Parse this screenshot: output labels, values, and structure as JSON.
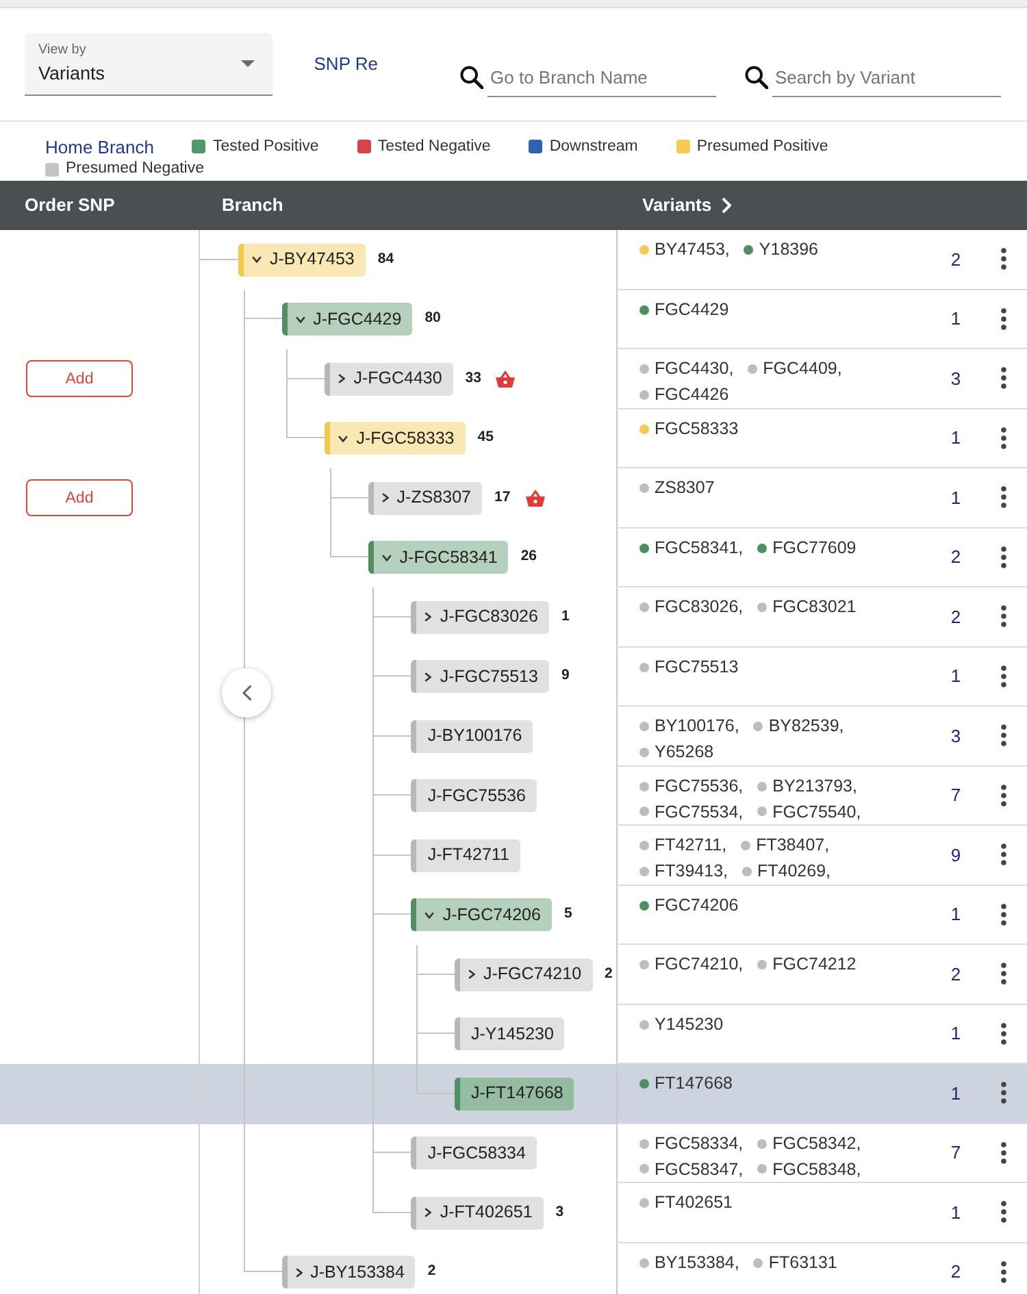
{
  "toolbar": {
    "view_by": {
      "label": "View by",
      "value": "Variants"
    },
    "tab": "SNP Re",
    "branch_search": {
      "placeholder": "Go to Branch Name"
    },
    "variant_search": {
      "placeholder": "Search by Variant"
    }
  },
  "legend": {
    "home_branch": "Home Branch",
    "items": [
      {
        "label": "Tested Positive",
        "color": "#4e9a66"
      },
      {
        "label": "Tested Negative",
        "color": "#d64545"
      },
      {
        "label": "Downstream",
        "color": "#2f63ad"
      },
      {
        "label": "Presumed Positive",
        "color": "#f6c94f"
      },
      {
        "label": "Presumed Negative",
        "color": "#c4c4c4"
      }
    ]
  },
  "table": {
    "columns": [
      {
        "label": "Order SNP",
        "kind": "plain"
      },
      {
        "label": "Branch",
        "kind": "plain"
      },
      {
        "label": "Variants",
        "kind": "expandable"
      }
    ],
    "tree": [
      {
        "name": "J-BY47453",
        "color": "#f2c94c",
        "kind": "parent",
        "expanded": true,
        "count": "84",
        "basket": false,
        "selected": false,
        "variants": [
          {
            "name": "BY47453,",
            "color": "#f6c94f"
          },
          {
            "name": "Y18396",
            "color": "#4e8f60"
          }
        ],
        "variant_count": "2",
        "children": [
          {
            "name": "J-FGC4429",
            "color": "#4f8f60",
            "kind": "parent",
            "expanded": true,
            "count": "80",
            "basket": false,
            "selected": false,
            "variants": [
              {
                "name": "FGC4429",
                "color": "#4e8f60"
              }
            ],
            "variant_count": "1",
            "children": [
              {
                "name": "J-FGC4430",
                "color": "#b8b8b8",
                "kind": "parent",
                "expanded": false,
                "count": "33",
                "basket": true,
                "order_button": "Add",
                "selected": false,
                "variants": [
                  {
                    "name": "FGC4430,",
                    "color": "#bdbdbd"
                  },
                  {
                    "name": "FGC4409,",
                    "color": "#bdbdbd"
                  },
                  {
                    "name": "FGC4426",
                    "color": "#bdbdbd"
                  }
                ],
                "variant_count": "3"
              },
              {
                "name": "J-FGC58333",
                "color": "#f2c94c",
                "kind": "parent",
                "expanded": true,
                "count": "45",
                "basket": false,
                "selected": false,
                "variants": [
                  {
                    "name": "FGC58333",
                    "color": "#f6c94f"
                  }
                ],
                "variant_count": "1",
                "children": [
                  {
                    "name": "J-ZS8307",
                    "color": "#b8b8b8",
                    "kind": "parent",
                    "expanded": false,
                    "count": "17",
                    "basket": true,
                    "order_button": "Add",
                    "selected": false,
                    "variants": [
                      {
                        "name": "ZS8307",
                        "color": "#bdbdbd"
                      }
                    ],
                    "variant_count": "1"
                  },
                  {
                    "name": "J-FGC58341",
                    "color": "#4f8f60",
                    "kind": "parent",
                    "expanded": true,
                    "count": "26",
                    "basket": false,
                    "selected": false,
                    "variants": [
                      {
                        "name": "FGC58341,",
                        "color": "#4e8f60"
                      },
                      {
                        "name": "FGC77609",
                        "color": "#4e8f60"
                      }
                    ],
                    "variant_count": "2",
                    "children": [
                      {
                        "name": "J-FGC83026",
                        "color": "#b8b8b8",
                        "kind": "parent",
                        "expanded": false,
                        "count": "1",
                        "basket": false,
                        "selected": false,
                        "variants": [
                          {
                            "name": "FGC83026,",
                            "color": "#bdbdbd"
                          },
                          {
                            "name": "FGC83021",
                            "color": "#bdbdbd"
                          }
                        ],
                        "variant_count": "2"
                      },
                      {
                        "name": "J-FGC75513",
                        "color": "#b8b8b8",
                        "kind": "parent",
                        "expanded": false,
                        "count": "9",
                        "basket": false,
                        "selected": false,
                        "variants": [
                          {
                            "name": "FGC75513",
                            "color": "#bdbdbd"
                          }
                        ],
                        "variant_count": "1"
                      },
                      {
                        "name": "J-BY100176",
                        "color": "#b8b8b8",
                        "kind": "leaf",
                        "basket": false,
                        "selected": false,
                        "variants": [
                          {
                            "name": "BY100176,",
                            "color": "#bdbdbd"
                          },
                          {
                            "name": "BY82539,",
                            "color": "#bdbdbd"
                          },
                          {
                            "name": "Y65268",
                            "color": "#bdbdbd"
                          }
                        ],
                        "variant_count": "3"
                      },
                      {
                        "name": "J-FGC75536",
                        "color": "#b8b8b8",
                        "kind": "leaf",
                        "basket": false,
                        "selected": false,
                        "variants": [
                          {
                            "name": "FGC75536,",
                            "color": "#bdbdbd"
                          },
                          {
                            "name": "BY213793,",
                            "color": "#bdbdbd"
                          },
                          {
                            "name": "FGC75534,",
                            "color": "#bdbdbd"
                          },
                          {
                            "name": "FGC75540,",
                            "color": "#bdbdbd"
                          }
                        ],
                        "variant_count": "7"
                      },
                      {
                        "name": "J-FT42711",
                        "color": "#b8b8b8",
                        "kind": "leaf",
                        "basket": false,
                        "selected": false,
                        "variants": [
                          {
                            "name": "FT42711,",
                            "color": "#bdbdbd"
                          },
                          {
                            "name": "FT38407,",
                            "color": "#bdbdbd"
                          },
                          {
                            "name": "FT39413,",
                            "color": "#bdbdbd"
                          },
                          {
                            "name": "FT40269,",
                            "color": "#bdbdbd"
                          }
                        ],
                        "variant_count": "9"
                      },
                      {
                        "name": "J-FGC74206",
                        "color": "#4f8f60",
                        "kind": "parent",
                        "expanded": true,
                        "count": "5",
                        "basket": false,
                        "selected": false,
                        "variants": [
                          {
                            "name": "FGC74206",
                            "color": "#4e8f60"
                          }
                        ],
                        "variant_count": "1",
                        "children": [
                          {
                            "name": "J-FGC74210",
                            "color": "#b8b8b8",
                            "kind": "parent",
                            "expanded": false,
                            "count": "2",
                            "basket": false,
                            "selected": false,
                            "variants": [
                              {
                                "name": "FGC74210,",
                                "color": "#bdbdbd"
                              },
                              {
                                "name": "FGC74212",
                                "color": "#bdbdbd"
                              }
                            ],
                            "variant_count": "2"
                          },
                          {
                            "name": "J-Y145230",
                            "color": "#b8b8b8",
                            "kind": "leaf",
                            "basket": false,
                            "selected": false,
                            "variants": [
                              {
                                "name": "Y145230",
                                "color": "#bdbdbd"
                              }
                            ],
                            "variant_count": "1"
                          },
                          {
                            "name": "J-FT147668",
                            "color": "#4f8f60",
                            "kind": "leaf",
                            "basket": false,
                            "selected": true,
                            "variants": [
                              {
                                "name": "FT147668",
                                "color": "#4e8f60"
                              }
                            ],
                            "variant_count": "1"
                          }
                        ]
                      },
                      {
                        "name": "J-FGC58334",
                        "color": "#b8b8b8",
                        "kind": "leaf",
                        "basket": false,
                        "selected": false,
                        "variants": [
                          {
                            "name": "FGC58334,",
                            "color": "#bdbdbd"
                          },
                          {
                            "name": "FGC58342,",
                            "color": "#bdbdbd"
                          },
                          {
                            "name": "FGC58347,",
                            "color": "#bdbdbd"
                          },
                          {
                            "name": "FGC58348,",
                            "color": "#bdbdbd"
                          }
                        ],
                        "variant_count": "7"
                      },
                      {
                        "name": "J-FT402651",
                        "color": "#b8b8b8",
                        "kind": "parent",
                        "expanded": false,
                        "count": "3",
                        "basket": false,
                        "selected": false,
                        "variants": [
                          {
                            "name": "FT402651",
                            "color": "#bdbdbd"
                          }
                        ],
                        "variant_count": "1"
                      }
                    ]
                  }
                ]
              }
            ]
          },
          {
            "name": "J-BY153384",
            "color": "#b8b8b8",
            "kind": "parent",
            "expanded": false,
            "count": "2",
            "basket": false,
            "selected": false,
            "variants": [
              {
                "name": "BY153384,",
                "color": "#bdbdbd"
              },
              {
                "name": "FT63131",
                "color": "#bdbdbd"
              }
            ],
            "variant_count": "2"
          }
        ]
      }
    ]
  }
}
